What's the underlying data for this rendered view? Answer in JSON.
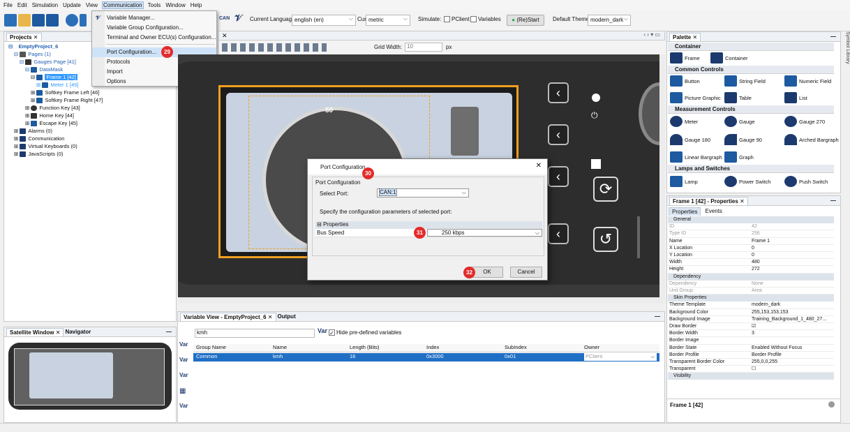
{
  "menubar": {
    "items": [
      "File",
      "Edit",
      "Simulation",
      "Update",
      "View",
      "Communication",
      "Tools",
      "Window",
      "Help"
    ]
  },
  "toolbar": {
    "lang_label": "Current Language",
    "lang_value": "english (en)",
    "unit_label": "Current Unit",
    "unit_value": "metric",
    "simulate_label": "Simulate:",
    "pclient_label": "PClient",
    "variables_label": "Variables",
    "restart_label": "(Re)Start",
    "theme_label": "Default Theme",
    "theme_value": "modern_dark",
    "can_label": "CAN"
  },
  "menu": {
    "items": [
      "Variable Manager...",
      "Variable Group Configuration...",
      "Terminal and Owner ECU(s) Configuration...",
      "Port Configuration...",
      "Protocols",
      "Import",
      "Options"
    ],
    "badge": "29"
  },
  "projects": {
    "tab": "Projects",
    "root": "EmptyProject_6",
    "pages": "Pages (1)",
    "gauges_page": "Gauges Page [41]",
    "datamask": "DataMask",
    "frame1": "Frame 1 [42]",
    "meter1": "Meter 1 [49]",
    "softkey_left": "Softkey Frame Left [46]",
    "softkey_right": "Softkey Frame Right [47]",
    "function_key": "Function Key [43]",
    "home_key": "Home Key [44]",
    "escape_key": "Escape Key [45]",
    "alarms": "Alarms (0)",
    "communication": "Communication",
    "virtual_keyboards": "Virtual Keyboards (0)",
    "javascripts": "JavaScripts (0)"
  },
  "editor": {
    "grid_label": "Grid Width:",
    "grid_value": "10",
    "grid_unit": "px",
    "gauge_value": "50"
  },
  "dialog": {
    "title": "Port Configuration",
    "group": "Port Configuration",
    "select_label": "Select Port:",
    "select_value": "CAN:1",
    "desc": "Specify the configuration parameters of selected port:",
    "props_label": "Properties",
    "bus_label": "Bus Speed",
    "bus_value": "250 kbps",
    "ok": "OK",
    "cancel": "Cancel",
    "badge30": "30",
    "badge31": "31",
    "badge32": "32"
  },
  "satellite": {
    "tab1": "Satellite Window",
    "tab2": "Navigator"
  },
  "varview": {
    "tab": "Variable View - EmptyProject_6",
    "tab2": "Output",
    "filter": "kmh",
    "hide_label": "Hide pre-defined variables",
    "headers": [
      "Group Name",
      "Name",
      "Length (Bits)",
      "Index",
      "SubIndex",
      "Owner"
    ],
    "row": [
      "Common",
      "kmh",
      "16",
      "0x3000",
      "0x01",
      "PClient"
    ]
  },
  "palette": {
    "tab": "Palette",
    "sections": [
      "Container",
      "Common Controls",
      "Measurement Controls",
      "Lamps and Switches"
    ],
    "container": [
      "Frame",
      "Container"
    ],
    "common": [
      "Button",
      "String Field",
      "Numeric Field",
      "Picture Graphic",
      "Table",
      "List"
    ],
    "measurement": [
      "Meter",
      "Gauge",
      "Gauge 270",
      "Gauge 180",
      "Gauge 90",
      "Arched Bargraph",
      "Linear Bargraph",
      "Graph"
    ],
    "lamps": [
      "Lamp",
      "Power Switch",
      "Push Switch"
    ],
    "side_label": "Symbol Library"
  },
  "props": {
    "tab": "Frame 1 [42] - Properties",
    "tabs": [
      "Properties",
      "Events"
    ],
    "general": "General",
    "rows1": [
      [
        "ID",
        "42",
        true
      ],
      [
        "Type ID",
        "256",
        true
      ],
      [
        "Name",
        "Frame 1",
        false
      ],
      [
        "X Location",
        "0",
        false
      ],
      [
        "Y Location",
        "0",
        false
      ],
      [
        "Width",
        "480",
        false
      ],
      [
        "Height",
        "272",
        false
      ]
    ],
    "dependency": "Dependency",
    "rows2": [
      [
        "Dependency",
        "None",
        true
      ],
      [
        "Unit Group",
        "Area",
        true
      ]
    ],
    "skin": "Skin Properties",
    "rows3": [
      [
        "Theme Template",
        "modern_dark",
        false
      ],
      [
        "Background Color",
        "255,153,153,153",
        false
      ],
      [
        "Background Image",
        "Training_Background_1_480_27...",
        false
      ],
      [
        "Draw Border",
        "☑",
        false
      ],
      [
        "Border Width",
        "3",
        false
      ],
      [
        "Border Image",
        "",
        false
      ],
      [
        "Border State",
        "Enabled Without Focus",
        false
      ],
      [
        "Border Profile",
        "Border Profile",
        false
      ],
      [
        "Transparent Border Color",
        "255,0,0,255",
        false
      ],
      [
        "Transparent",
        "☐",
        false
      ]
    ],
    "visibility": "Visibility",
    "footer": "Frame 1 [42]"
  },
  "colors": {
    "accent": "#2a6fbf",
    "badge": "#e32b2b",
    "selected_row": "#1f6fc5",
    "tree_selected": "#3399ff"
  }
}
